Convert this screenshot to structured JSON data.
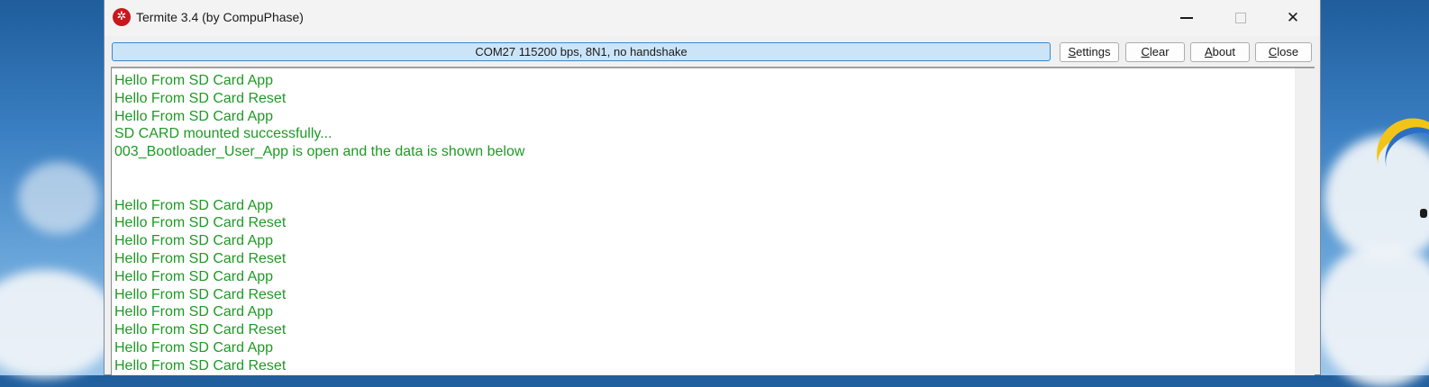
{
  "window": {
    "title": "Termite 3.4 (by CompuPhase)",
    "app_icon_glyph": "✲"
  },
  "toolbar": {
    "status": "COM27 115200 bps, 8N1, no handshake",
    "settings": {
      "accel": "S",
      "rest": "ettings"
    },
    "clear": {
      "accel": "C",
      "rest": "lear"
    },
    "about": {
      "accel": "A",
      "rest": "bout"
    },
    "close": {
      "accel": "C",
      "rest": "lose"
    }
  },
  "terminal": {
    "text_color": "#1e9a24",
    "lines": [
      "Hello From SD Card App",
      "Hello From SD Card Reset",
      "Hello From SD Card App",
      "SD CARD mounted successfully...",
      "003_Bootloader_User_App is open and the data is shown below",
      "",
      "",
      "Hello From SD Card App",
      "Hello From SD Card Reset",
      "Hello From SD Card App",
      "Hello From SD Card Reset",
      "Hello From SD Card App",
      "Hello From SD Card Reset",
      "Hello From SD Card App",
      "Hello From SD Card Reset",
      "Hello From SD Card App",
      "Hello From SD Card Reset"
    ]
  },
  "icons": {
    "minimize": "minimize-icon",
    "maximize": "maximize-icon",
    "close": "close-icon",
    "app": "termite-app-icon"
  }
}
